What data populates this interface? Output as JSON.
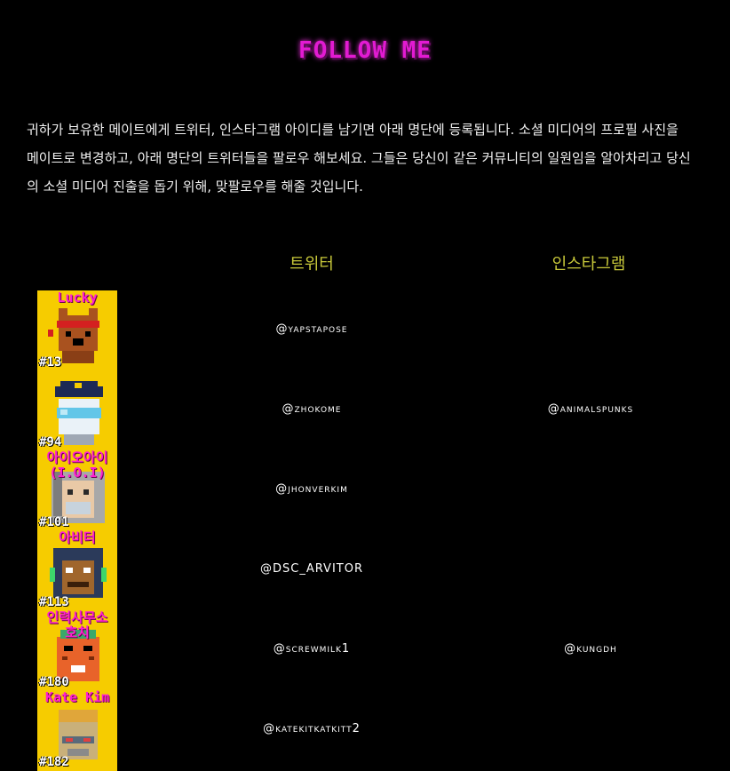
{
  "page": {
    "title": "FOLLOW ME",
    "intro": "귀하가 보유한 메이트에게 트위터, 인스타그램 아이디를 남기면 아래 명단에 등록됩니다. 소셜 미디어의 프로필 사진을 메이트로 변경하고, 아래 명단의 트위터들을 팔로우 해보세요. 그들은 당신이 같은 커뮤니티의 일원임을 알아차리고 당신의 소셜 미디어 진출을 돕기 위해, 맞팔로우를 해줄 것입니다."
  },
  "columns": {
    "twitter": "트위터",
    "instagram": "인스타그램"
  },
  "colors": {
    "title": "#e21bd2",
    "column_head": "#c9c93a",
    "strip": "#f6cc00",
    "name": "#ff1fd0"
  },
  "rows": [
    {
      "name": "Lucky",
      "number": "#13",
      "twitter": "@yapstapose",
      "instagram": "",
      "icon": "dog-mate-icon"
    },
    {
      "name": "",
      "number": "#94",
      "twitter": "@zhokome",
      "instagram": "@animalspunks",
      "icon": "police-mate-icon"
    },
    {
      "name": "아이오아이(I.O.I)",
      "number": "#101",
      "twitter": "@jhonverkim",
      "instagram": "",
      "icon": "gray-hair-mate-icon"
    },
    {
      "name": "아비터",
      "number": "#113",
      "twitter": "@DSC_ARVITOR",
      "instagram": "",
      "icon": "helmet-mate-icon"
    },
    {
      "name": "인력사무소 호치",
      "number": "#180",
      "twitter": "@screwmilk1",
      "instagram": "@kungdh",
      "icon": "tiger-mate-icon"
    },
    {
      "name": "Kate Kim",
      "number": "#182",
      "twitter": "@katekitkatkitt2",
      "instagram": "",
      "icon": "robot-mate-icon"
    }
  ]
}
